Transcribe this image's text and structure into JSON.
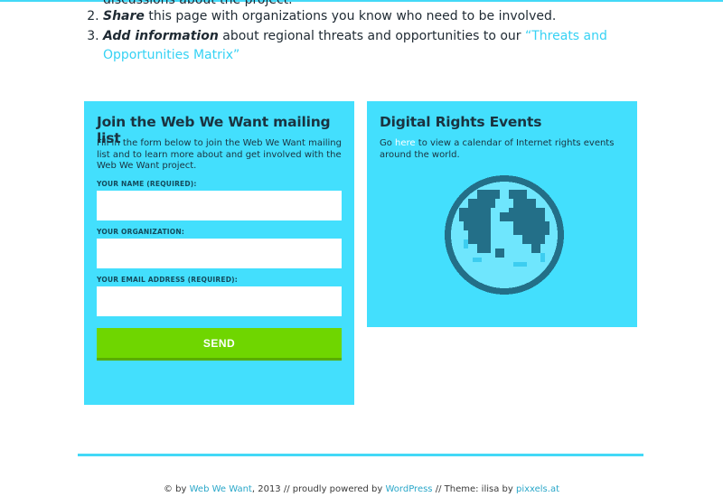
{
  "intro": {
    "clipped_line": "discussions about the project.",
    "steps": [
      {
        "number": "2.",
        "bold": "Share",
        "text": " this page with organizations you know who need to be involved.",
        "link": ""
      },
      {
        "number": "3.",
        "bold": "Add information",
        "text": " about regional threats and opportunities to our ",
        "link": "“Threats and Opportunities Matrix”"
      }
    ]
  },
  "mailing_list": {
    "title": "Join the Web We Want mailing list",
    "description": "Fill in the form below to join the Web We Want mailing list and to learn more about and get involved with the Web We Want project.",
    "fields": [
      {
        "label": "YOUR NAME (REQUIRED):",
        "value": ""
      },
      {
        "label": "YOUR ORGANIZATION:",
        "value": ""
      },
      {
        "label": "YOUR EMAIL ADDRESS (REQUIRED):",
        "value": ""
      }
    ],
    "send_label": "SEND"
  },
  "events": {
    "title": "Digital Rights Events",
    "text_before": "Go ",
    "link": "here",
    "text_after": " to view a calendar of Internet rights events around the world.",
    "globe_icon": "globe-icon"
  },
  "footer": {
    "copyright": "© by ",
    "site_link": "Web We Want",
    "middle": ", 2013 // proudly powered by ",
    "wp_link": "WordPress",
    "theme": " // Theme: ilisa by ",
    "author_link": "pixxels.at"
  },
  "colors": {
    "accent": "#43dffd",
    "send_button": "#6fd600",
    "link": "#36d2f4",
    "globe_dark": "#236f88"
  }
}
